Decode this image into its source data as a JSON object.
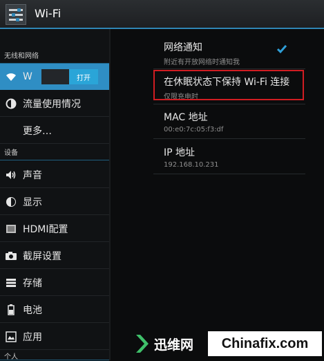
{
  "action_bar": {
    "title": "Wi-Fi",
    "icon": "settings-sliders-icon"
  },
  "sidebar": {
    "sections": [
      {
        "header": "无线和网络"
      },
      {
        "header": "设备"
      },
      {
        "header": "个人"
      }
    ],
    "items": [
      {
        "label": "W",
        "icon": "wifi-icon",
        "toggle": "打开"
      },
      {
        "label": "流量使用情况",
        "icon": "data-usage-icon"
      },
      {
        "label": "更多…",
        "icon": ""
      },
      {
        "label": "声音",
        "icon": "volume-icon"
      },
      {
        "label": "显示",
        "icon": "brightness-icon"
      },
      {
        "label": "HDMI配置",
        "icon": "hdmi-icon"
      },
      {
        "label": "截屏设置",
        "icon": "camera-icon"
      },
      {
        "label": "存储",
        "icon": "storage-icon"
      },
      {
        "label": "电池",
        "icon": "battery-icon"
      },
      {
        "label": "应用",
        "icon": "apps-icon"
      }
    ]
  },
  "prefs": [
    {
      "title": "网络通知",
      "summary": "附近有开放网络时通知我",
      "checked": true
    },
    {
      "title": "在休眠状态下保持 Wi-Fi 连接",
      "summary": "仅限充电时"
    },
    {
      "title": "MAC 地址",
      "summary": "00:e0:7c:05:f3:df"
    },
    {
      "title": "IP 地址",
      "summary": "192.168.10.231"
    }
  ],
  "watermark": {
    "left": "迅维网",
    "right": "Chinafix.com"
  },
  "colors": {
    "accent": "#2f8ec4",
    "highlight": "#d11d22",
    "background": "#0b0c0d"
  }
}
